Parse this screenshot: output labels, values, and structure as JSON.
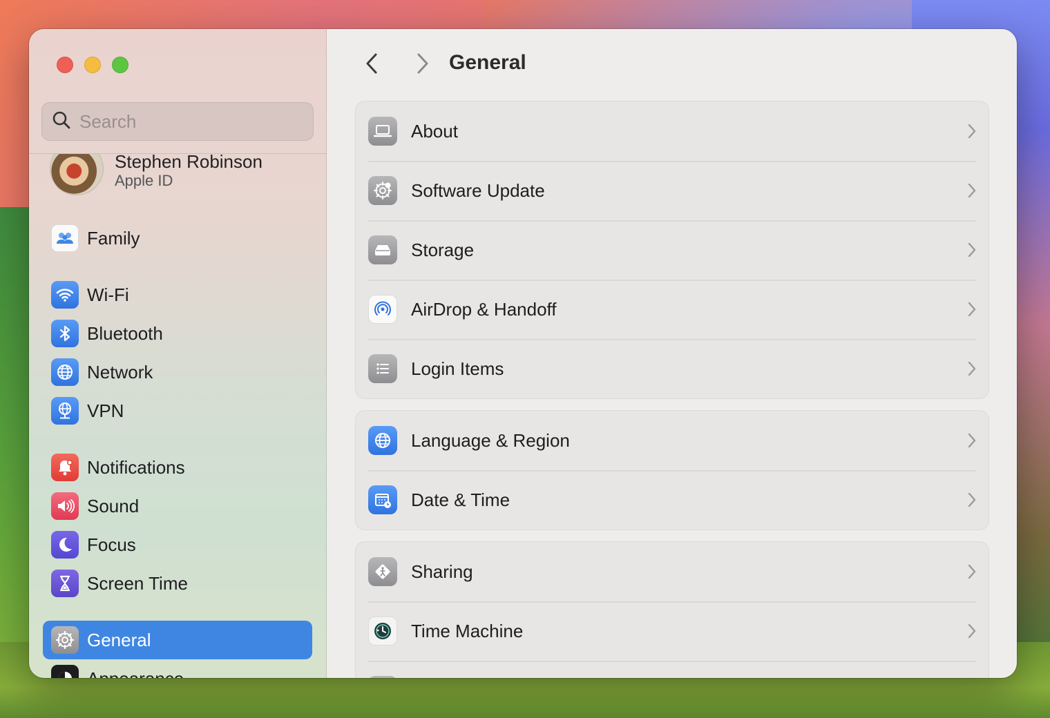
{
  "window": {
    "title": "General"
  },
  "search": {
    "placeholder": "Search"
  },
  "account": {
    "name": "Stephen Robinson",
    "subtitle": "Apple ID"
  },
  "sidebar": {
    "items": [
      {
        "label": "Family",
        "icon": "family-icon"
      },
      {
        "label": "Wi-Fi",
        "icon": "wifi-icon"
      },
      {
        "label": "Bluetooth",
        "icon": "bluetooth-icon"
      },
      {
        "label": "Network",
        "icon": "network-globe-icon"
      },
      {
        "label": "VPN",
        "icon": "vpn-icon"
      },
      {
        "label": "Notifications",
        "icon": "notifications-bell-icon"
      },
      {
        "label": "Sound",
        "icon": "speaker-icon"
      },
      {
        "label": "Focus",
        "icon": "moon-icon"
      },
      {
        "label": "Screen Time",
        "icon": "hourglass-icon"
      },
      {
        "label": "General",
        "icon": "gear-icon",
        "selected": true
      },
      {
        "label": "Appearance",
        "icon": "appearance-icon"
      }
    ]
  },
  "main": {
    "title": "General",
    "groups": [
      [
        {
          "label": "About",
          "icon": "laptop-icon"
        },
        {
          "label": "Software Update",
          "icon": "software-update-gear-icon"
        },
        {
          "label": "Storage",
          "icon": "drive-icon"
        },
        {
          "label": "AirDrop & Handoff",
          "icon": "airdrop-icon"
        },
        {
          "label": "Login Items",
          "icon": "list-icon"
        }
      ],
      [
        {
          "label": "Language & Region",
          "icon": "globe-icon"
        },
        {
          "label": "Date & Time",
          "icon": "calendar-clock-icon"
        }
      ],
      [
        {
          "label": "Sharing",
          "icon": "sharing-icon"
        },
        {
          "label": "Time Machine",
          "icon": "time-machine-icon"
        }
      ]
    ]
  },
  "colors": {
    "accent": "#3f86e3",
    "window_bg": "#efedec"
  }
}
